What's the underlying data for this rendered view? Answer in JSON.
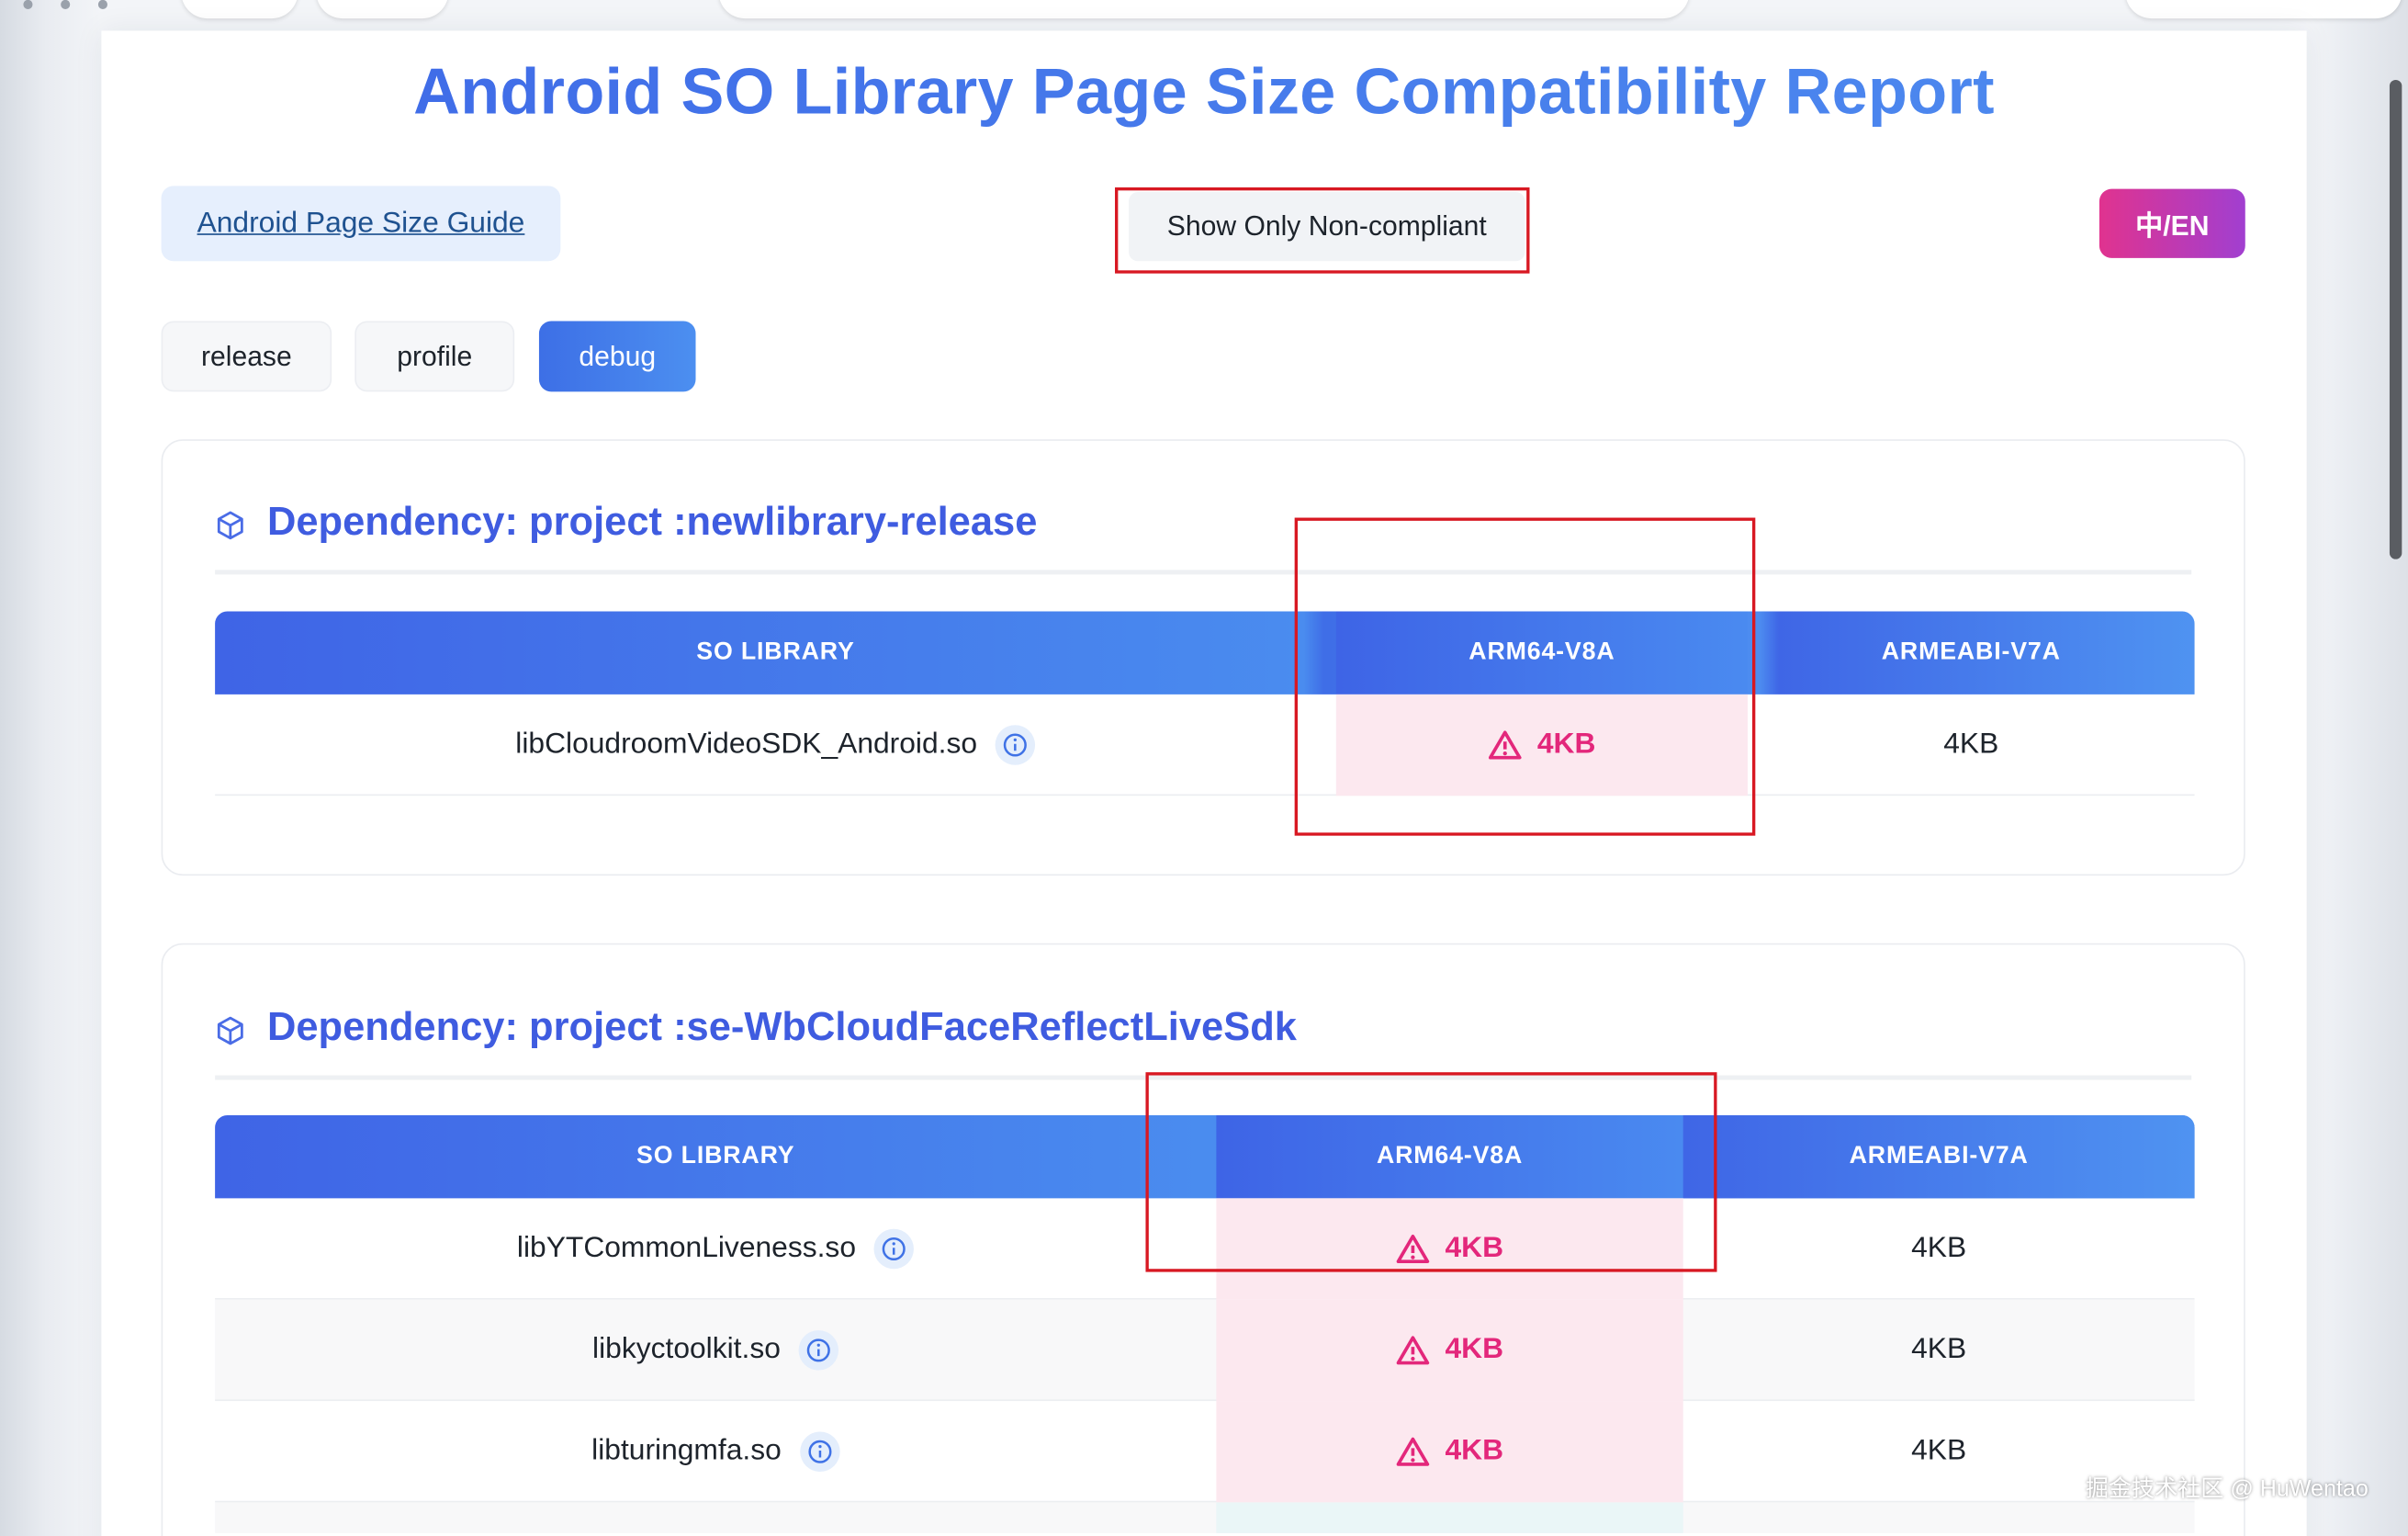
{
  "title": "Android SO Library Page Size Compatibility Report",
  "toolbar": {
    "guide_label": "Android Page Size Guide",
    "filter_label": "Show Only Non-compliant",
    "lang_label": "中/EN"
  },
  "tabs": [
    {
      "label": "release",
      "active": false
    },
    {
      "label": "profile",
      "active": false
    },
    {
      "label": "debug",
      "active": true
    }
  ],
  "columns": {
    "lib": "SO LIBRARY",
    "arm64": "ARM64-V8A",
    "armeabi": "ARMEABI-V7A"
  },
  "sections": [
    {
      "title": "Dependency: project :newlibrary-release",
      "rows": [
        {
          "name": "libCloudroomVideoSDK_Android.so",
          "arm64": "4KB",
          "armeabi": "4KB"
        }
      ]
    },
    {
      "title": "Dependency: project :se-WbCloudFaceReflectLiveSdk",
      "rows": [
        {
          "name": "libYTCommonLiveness.so",
          "arm64": "4KB",
          "armeabi": "4KB"
        },
        {
          "name": "libkyctoolkit.so",
          "arm64": "4KB",
          "armeabi": "4KB"
        },
        {
          "name": "libturingmfa.so",
          "arm64": "4KB",
          "armeabi": "4KB"
        }
      ]
    }
  ],
  "colors": {
    "accent": "#4a6ce6",
    "warn": "#e3277b",
    "warn_bg": "#fce8ef",
    "highlight": "#d81822"
  },
  "watermark": "掘金技术社区 @ HuWentao"
}
